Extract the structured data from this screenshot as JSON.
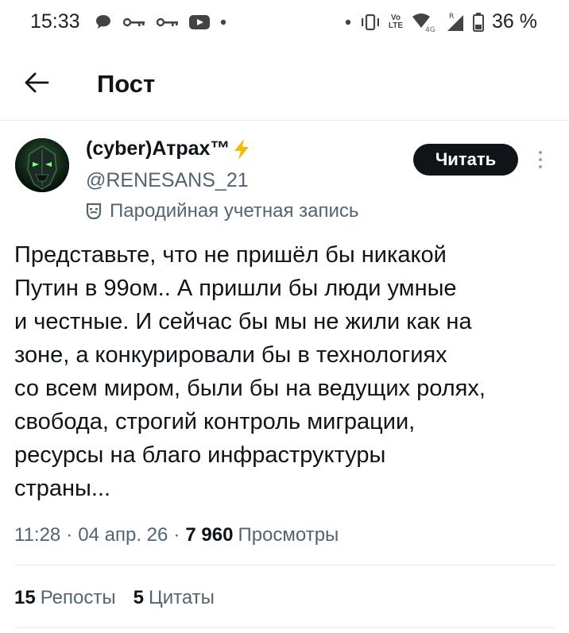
{
  "status_bar": {
    "time": "15:33",
    "battery": "36 %",
    "network_label": "LTE",
    "network_gen": "4G",
    "roaming": "R"
  },
  "header": {
    "title": "Пост"
  },
  "post": {
    "author_name": "(cyber)Атрах™",
    "author_emoji": "⚡",
    "handle": "@RENESANS_21",
    "parody_label": "Пародийная учетная запись",
    "follow_label": "Читать",
    "text": "Представьте, что не пришёл бы никакой\nПутин в 99ом.. А пришли бы люди умные\nи честные. И сейчас бы мы не жили как на\nзоне, а конкурировали бы в технологиях\nсо всем миром, были бы на ведущих ролях,\nсвобода, строгий контроль миграции,\nресурсы на благо инфраструктуры\nстраны...",
    "time": "11:28",
    "date": "04 апр. 26",
    "views_count": "7 960",
    "views_label": "Просмотры",
    "separator": "·",
    "reposts_count": "15",
    "reposts_label": "Репосты",
    "quotes_count": "5",
    "quotes_label": "Цитаты"
  },
  "icons": {
    "back": "arrow-left-icon",
    "more": "more-vertical-icon",
    "parody": "theater-mask-icon",
    "avatar": "avatar-image"
  },
  "colors": {
    "text_primary": "#0f1419",
    "text_secondary": "#536471",
    "follow_bg": "#0f1419",
    "emoji_yellow": "#f5b800",
    "divider": "#e7e9ea"
  }
}
